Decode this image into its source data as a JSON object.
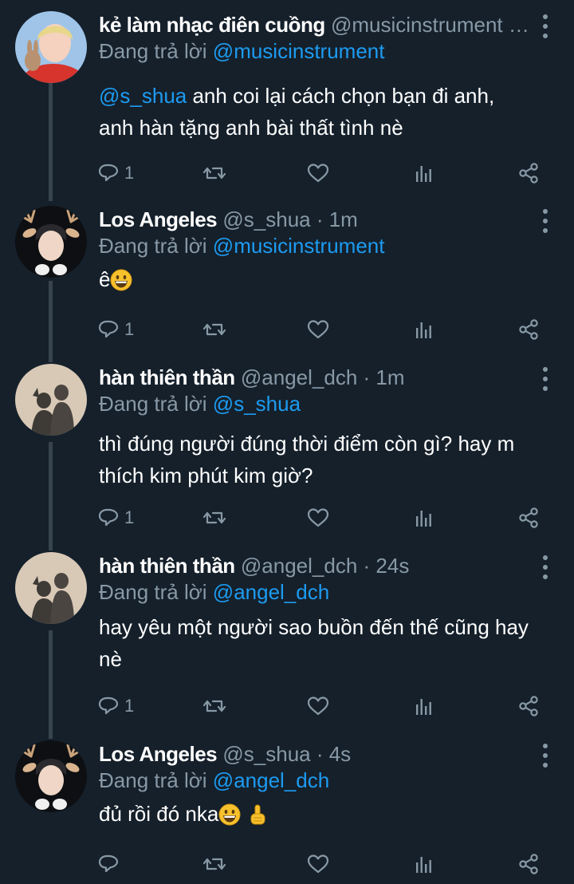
{
  "tweets": [
    {
      "name": "kẻ làm nhạc điên cuồng",
      "handle": "@musicinstrument …",
      "time": "",
      "reply_label": "Đang trả lời",
      "reply_to": "@musicinstrument",
      "text_mention": "@s_shua",
      "text": " anh coi lại cách chọn bạn đi anh,\nanh hàn tặng anh bài thất tình nè",
      "reply_count": "1",
      "avatar": "red-shirt-avatar"
    },
    {
      "name": "Los Angeles",
      "handle": "@s_shua",
      "time": " · 1m",
      "reply_label": "Đang trả lời",
      "reply_to": "@musicinstrument",
      "text_mention": "",
      "text": "ê",
      "emoji": "grinning-emoji",
      "reply_count": "1",
      "avatar": "deer-ears-avatar"
    },
    {
      "name": "hàn thiên thần",
      "handle": "@angel_dch",
      "time": " · 1m",
      "reply_label": "Đang trả lời",
      "reply_to": "@s_shua",
      "text_mention": "",
      "text": "thì đúng người đúng thời điểm còn gì? hay m\nthích kim phút kim giờ?",
      "reply_count": "1",
      "avatar": "shadow-avatar"
    },
    {
      "name": "hàn thiên thần",
      "handle": "@angel_dch",
      "time": " · 24s",
      "reply_label": "Đang trả lời",
      "reply_to": "@angel_dch",
      "text_mention": "",
      "text": "hay yêu một người sao buồn đến thế cũng hay\nnè",
      "reply_count": "1",
      "avatar": "shadow-avatar"
    },
    {
      "name": "Los Angeles",
      "handle": "@s_shua",
      "time": " · 4s",
      "reply_label": "Đang trả lời",
      "reply_to": "@angel_dch",
      "text_mention": "",
      "text": "đủ rồi đó nka",
      "emoji": "grinning-emoji, pointing-up-emoji",
      "reply_count": "",
      "avatar": "deer-ears-avatar"
    }
  ],
  "icons": [
    "reply-icon",
    "retweet-icon",
    "like-icon",
    "analytics-icon",
    "share-icon",
    "more-icon"
  ],
  "colors": {
    "background": "#15202b",
    "secondary_text": "#8899a6",
    "accent": "#1d9bf0",
    "thread_line": "#38444d"
  }
}
